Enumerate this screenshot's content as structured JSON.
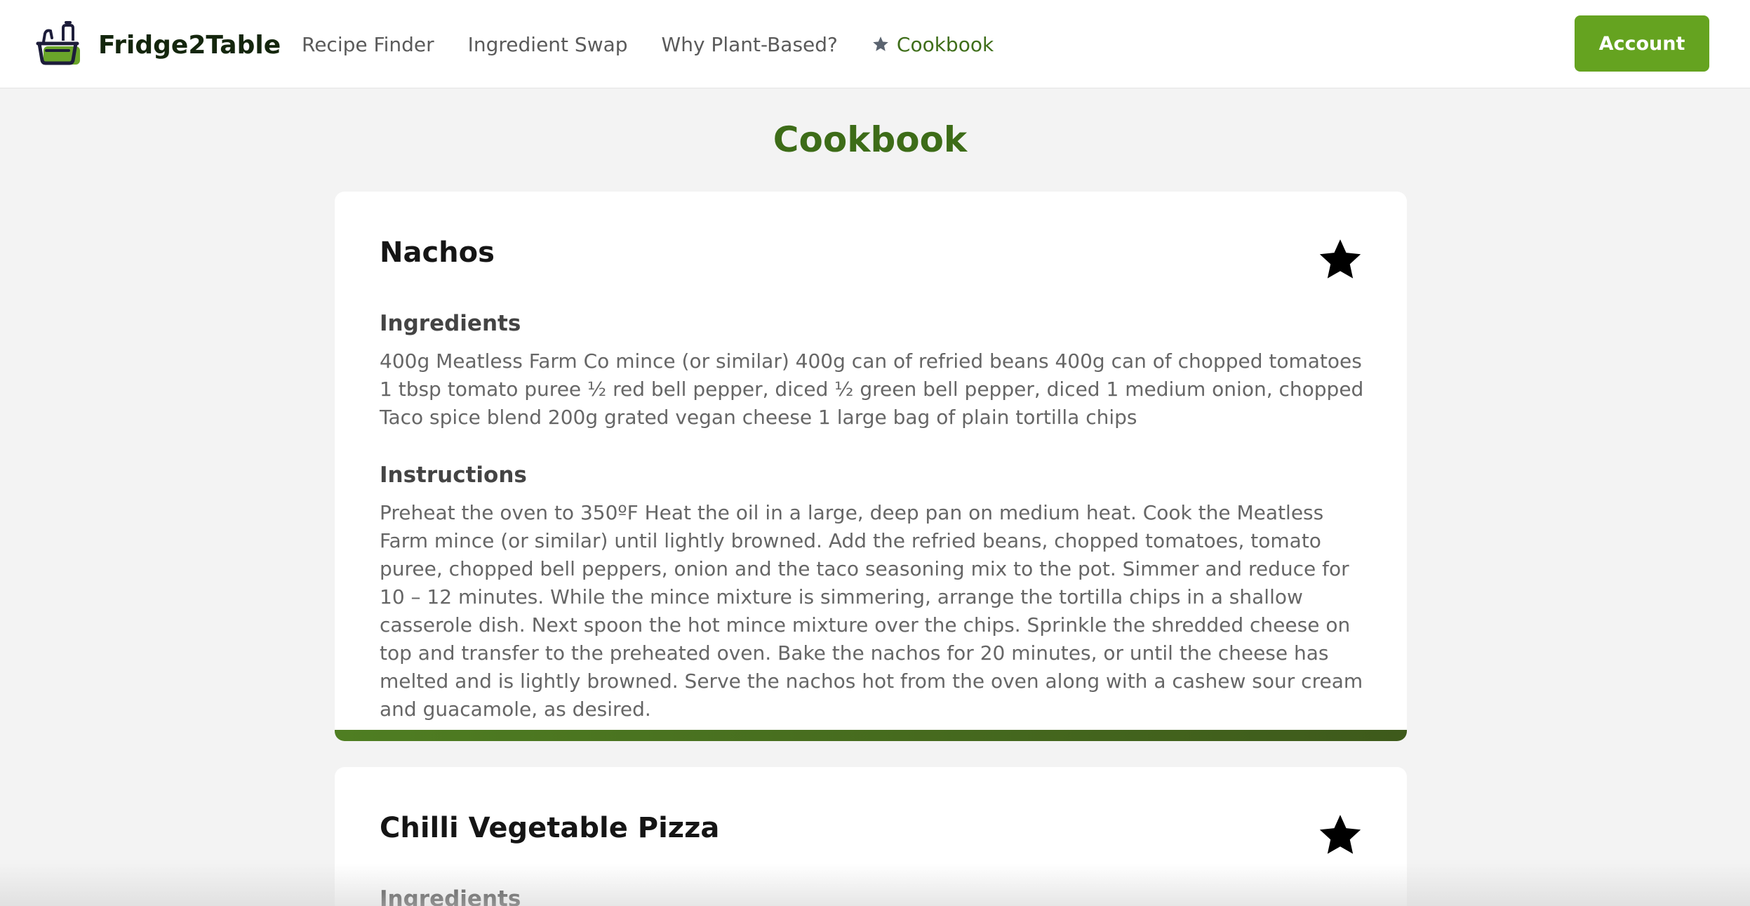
{
  "brand": {
    "name": "Fridge2Table",
    "icon": "basket-icon"
  },
  "nav": {
    "items": [
      {
        "label": "Recipe Finder"
      },
      {
        "label": "Ingredient Swap"
      },
      {
        "label": "Why Plant-Based?"
      },
      {
        "label": "Cookbook",
        "icon": "star-icon",
        "active": true
      }
    ]
  },
  "account": {
    "label": "Account"
  },
  "page": {
    "title": "Cookbook"
  },
  "recipes": [
    {
      "title": "Nachos",
      "favorite": true,
      "ingredients_heading": "Ingredients",
      "ingredients": "400g Meatless Farm Co mince (or similar) 400g can of refried beans 400g can of chopped tomatoes 1 tbsp tomato puree ½ red bell pepper, diced ½ green bell pepper, diced 1 medium onion, chopped Taco spice blend 200g grated vegan cheese 1 large bag of plain tortilla chips",
      "instructions_heading": "Instructions",
      "instructions": "Preheat the oven to 350ºF Heat the oil in a large, deep pan on medium heat. Cook the Meatless Farm mince (or similar) until lightly browned. Add the refried beans, chopped tomatoes, tomato puree, chopped bell peppers, onion and the taco seasoning mix to the pot. Simmer and reduce for 10 – 12 minutes. While the mince mixture is simmering, arrange the tortilla chips in a shallow casserole dish. Next spoon the hot mince mixture over the chips. Sprinkle the shredded cheese on top and transfer to the preheated oven. Bake the nachos for 20 minutes, or until the cheese has melted and is lightly browned. Serve the nachos hot from the oven along with a cashew sour cream and guacamole, as desired."
    },
    {
      "title": "Chilli Vegetable Pizza",
      "favorite": true,
      "ingredients_heading": "Ingredients"
    }
  ],
  "colors": {
    "accent": "#65a320",
    "title_green": "#3d6c18",
    "bar_start": "#4f7e22",
    "bar_end": "#3e5a1b",
    "background": "#f3f3f3"
  }
}
